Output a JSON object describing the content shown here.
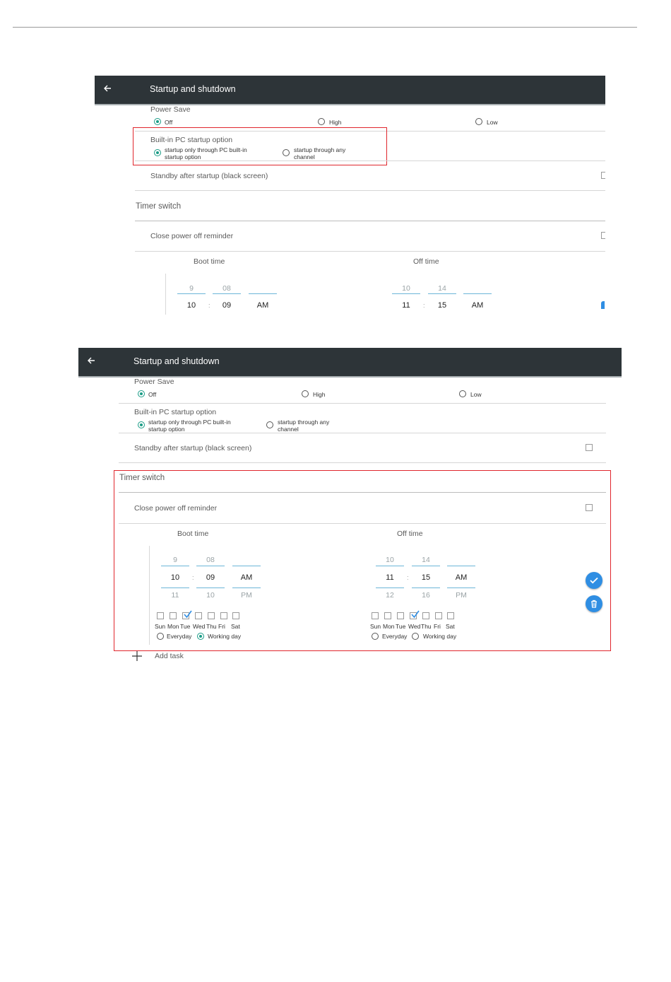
{
  "header": {
    "title": "Startup and shutdown"
  },
  "power_save": {
    "label": "Power Save",
    "options": [
      {
        "label": "Off",
        "selected": true
      },
      {
        "label": "High",
        "selected": false
      },
      {
        "label": "Low",
        "selected": false
      }
    ]
  },
  "pc_startup": {
    "label": "Built-in PC startup option",
    "options": [
      {
        "line1": "startup only through PC built-in",
        "line2": "startup option",
        "selected": true
      },
      {
        "line1": "startup through any",
        "line2": "channel",
        "selected": false
      }
    ]
  },
  "standby": {
    "label": "Standby after startup (black screen)",
    "checked": false
  },
  "timer": {
    "label": "Timer switch",
    "close_reminder": {
      "label": "Close power off reminder",
      "checked": false
    },
    "boot": {
      "label": "Boot time",
      "above": {
        "hour": "9",
        "minute": "08",
        "ampm": ""
      },
      "selected": {
        "hour": "10",
        "minute": "09",
        "ampm": "AM"
      },
      "below": {
        "hour": "11",
        "minute": "10",
        "ampm": "PM"
      },
      "days": [
        "Sun",
        "Mon",
        "Tue",
        "Wed",
        "Thu",
        "Fri",
        "Sat"
      ],
      "checked_day": "Tue",
      "repeat": [
        {
          "label": "Everyday",
          "selected": false
        },
        {
          "label": "Working day",
          "selected": true
        }
      ]
    },
    "off": {
      "label": "Off time",
      "above": {
        "hour": "10",
        "minute": "14",
        "ampm": ""
      },
      "selected": {
        "hour": "11",
        "minute": "15",
        "ampm": "AM"
      },
      "below": {
        "hour": "12",
        "minute": "16",
        "ampm": "PM"
      },
      "days": [
        "Sun",
        "Mon",
        "Tue",
        "Wed",
        "Thu",
        "Fri",
        "Sat"
      ],
      "checked_day": "Wed",
      "repeat": [
        {
          "label": "Everyday",
          "selected": false
        },
        {
          "label": "Working day",
          "selected": false
        }
      ]
    },
    "separator": ":"
  },
  "add_task": {
    "label": "Add task"
  },
  "colors": {
    "header_bg": "#2d3438",
    "accent_teal": "#1a9c86",
    "picker_underline": "#6cb6d8",
    "highlight_box": "#e0262d",
    "fab_blue": "#2f8ee3"
  },
  "icons": {
    "back": "arrow-left-icon",
    "confirm": "check-icon",
    "delete": "trash-icon",
    "add": "plus-icon"
  }
}
